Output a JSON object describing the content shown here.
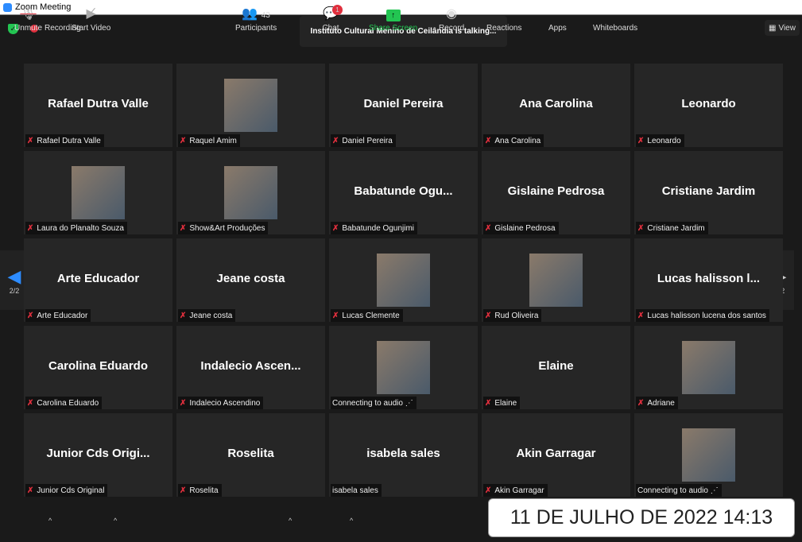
{
  "window": {
    "title": "Zoom Meeting"
  },
  "topbar": {
    "recording": "Recording",
    "talking": "Instituto Cultural Menino de Ceilândia is talking...",
    "view": "View"
  },
  "pagination": {
    "left": "2/2",
    "right": "2/2"
  },
  "tiles": [
    {
      "big": "Rafael Dutra Valle",
      "label": "Rafael Dutra Valle",
      "muted": true
    },
    {
      "big": "",
      "photo": true,
      "label": "Raquel Amim",
      "muted": true
    },
    {
      "big": "Daniel Pereira",
      "label": "Daniel Pereira",
      "muted": true
    },
    {
      "big": "Ana Carolina",
      "label": "Ana Carolina",
      "muted": true
    },
    {
      "big": "Leonardo",
      "label": "Leonardo",
      "muted": true
    },
    {
      "big": "",
      "photo": true,
      "label": "Laura do Planalto Souza",
      "muted": true
    },
    {
      "big": "",
      "photo": true,
      "label": "Show&Art Produções",
      "muted": true
    },
    {
      "big": "Babatunde Ogu...",
      "label": "Babatunde Ogunjimi",
      "muted": true
    },
    {
      "big": "Gislaine Pedrosa",
      "label": "Gislaine Pedrosa",
      "muted": true
    },
    {
      "big": "Cristiane Jardim",
      "label": "Cristiane Jardim",
      "muted": true
    },
    {
      "big": "Arte Educador",
      "label": "Arte Educador",
      "muted": true
    },
    {
      "big": "Jeane costa",
      "label": "Jeane costa",
      "muted": true
    },
    {
      "big": "",
      "photo": true,
      "label": "Lucas Clemente",
      "muted": true
    },
    {
      "big": "",
      "photo": true,
      "label": "Rud Oliveira",
      "muted": true
    },
    {
      "big": "Lucas halisson l...",
      "label": "Lucas halisson lucena dos santos",
      "muted": true
    },
    {
      "big": "Carolina Eduardo",
      "label": "Carolina Eduardo",
      "muted": true
    },
    {
      "big": "Indalecio Ascen...",
      "label": "Indalecio Ascendino",
      "muted": true
    },
    {
      "big": "",
      "photo": true,
      "label": "Connecting to audio ⋰",
      "muted": false
    },
    {
      "big": "Elaine",
      "label": "Elaine",
      "muted": true
    },
    {
      "big": "",
      "photo": true,
      "label": "Adriane",
      "muted": true
    },
    {
      "big": "Junior Cds Origi...",
      "label": "Junior Cds Original",
      "muted": true
    },
    {
      "big": "Roselita",
      "label": "Roselita",
      "muted": true
    },
    {
      "big": "isabela sales",
      "label": "isabela sales",
      "muted": false
    },
    {
      "big": "Akin Garragar",
      "label": "Akin Garragar",
      "muted": true
    },
    {
      "big": "",
      "photo": true,
      "label": "Connecting to audio ⋰",
      "muted": false
    }
  ],
  "toolbar": {
    "unmute": "Unmute",
    "start_video": "Start Video",
    "participants": "Participants",
    "participants_count": "43",
    "chat": "Chat",
    "chat_badge": "1",
    "share": "Share Screen",
    "record": "Record",
    "reactions": "Reactions",
    "apps": "Apps",
    "whiteboards": "Whiteboards"
  },
  "timestamp": "11 DE JULHO DE 2022 14:13",
  "colors": {
    "share": "#23c552",
    "muted": "#e02f3d"
  }
}
